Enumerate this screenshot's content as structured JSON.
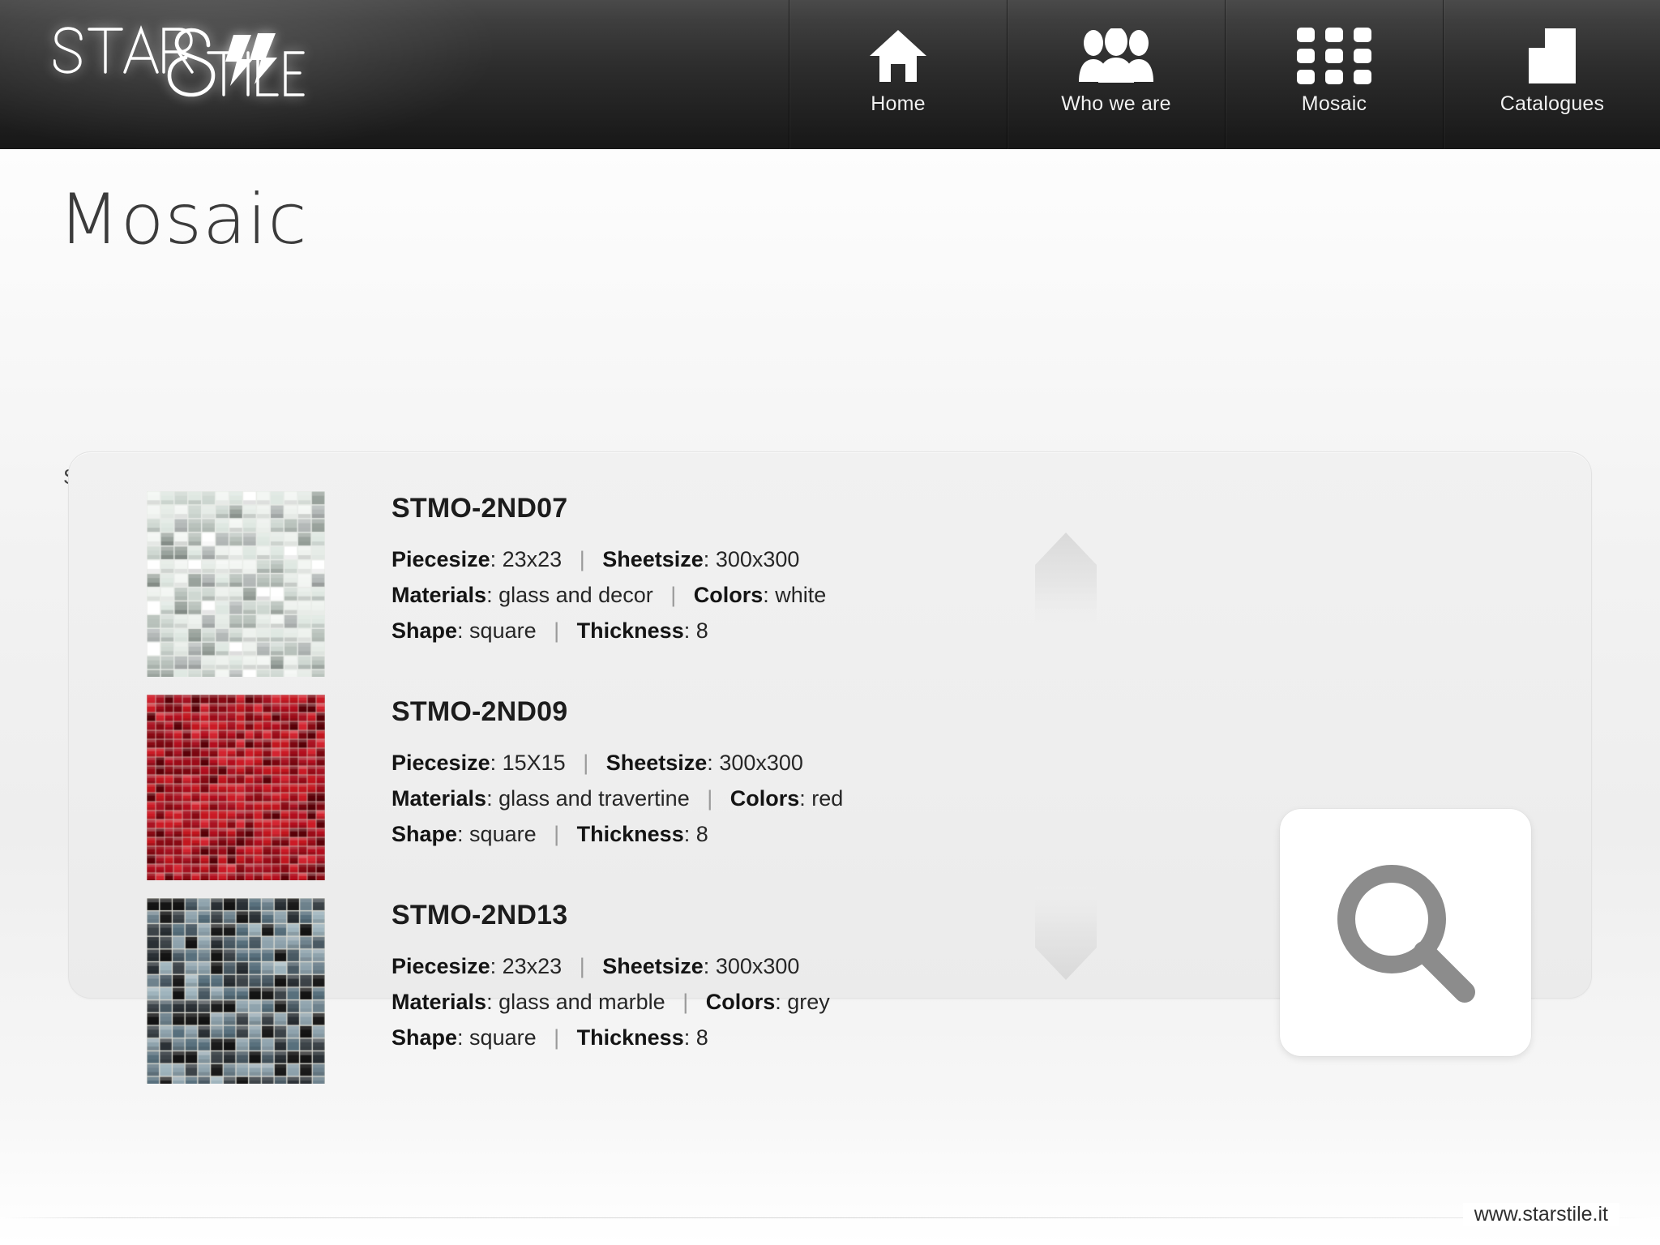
{
  "brand": {
    "name": "STARSTILE",
    "word_top": "STAR",
    "word_bottom": "STILE"
  },
  "nav": {
    "items": [
      {
        "label": "Home",
        "icon": "home-icon"
      },
      {
        "label": "Who we are",
        "icon": "people-icon"
      },
      {
        "label": "Mosaic",
        "icon": "grid-dots-icon"
      },
      {
        "label": "Catalogues",
        "icon": "document-icon"
      }
    ]
  },
  "main": {
    "title": "Mosaic",
    "subtitle": "Search results"
  },
  "labels": {
    "piecesize": "Piecesize",
    "sheetsize": "Sheetsize",
    "materials": "Materials",
    "colors": "Colors",
    "shape": "Shape",
    "thickness": "Thickness",
    "separator": "|"
  },
  "results": [
    {
      "sku": "STMO-2ND07",
      "piecesize": "23x23",
      "sheetsize": "300x300",
      "materials": "glass and decor",
      "colors": "white",
      "shape": "square",
      "thickness": "8",
      "swatch": {
        "palette": [
          "#ffffff",
          "#f3f6f3",
          "#e6ece7",
          "#dfe8e2",
          "#cfd8d2",
          "#b9c2bc",
          "#9aa39d",
          "#eef2ee"
        ],
        "accent": "#b4b9b8",
        "grid": 13,
        "grout": "#e9ece8"
      }
    },
    {
      "sku": "STMO-2ND09",
      "piecesize": "15X15",
      "sheetsize": "300x300",
      "materials": "glass and travertine",
      "colors": "red",
      "shape": "square",
      "thickness": "8",
      "swatch": {
        "palette": [
          "#b40f1f",
          "#c4161f",
          "#9d0c19",
          "#d42430",
          "#8b0a14",
          "#aa1322",
          "#cc1b26",
          "#7d0711"
        ],
        "accent": "#5c0008",
        "grid": 20,
        "grout": "#cfa9a4"
      }
    },
    {
      "sku": "STMO-2ND13",
      "piecesize": "23x23",
      "sheetsize": "300x300",
      "materials": "glass and marble",
      "colors": "grey",
      "shape": "square",
      "thickness": "8",
      "swatch": {
        "palette": [
          "#1b1b1b",
          "#2b3136",
          "#4a5a64",
          "#6e828d",
          "#8fa3ad",
          "#3d4449",
          "#141414",
          "#58707d"
        ],
        "accent": "#9fb4bd",
        "grid": 14,
        "grout": "#dcdcd4"
      }
    }
  ],
  "controls": {
    "scroll_up": "scroll-up-arrow",
    "scroll_down": "scroll-down-arrow",
    "search_button": "search-magnifier"
  },
  "footer": {
    "url": "www.starstile.it"
  },
  "colors": {
    "header_dark": "#262626",
    "page_bg": "#f2f2f2",
    "panel_bg": "#eeeeee",
    "text": "#262626",
    "icon_grey": "#8c8c8c"
  }
}
